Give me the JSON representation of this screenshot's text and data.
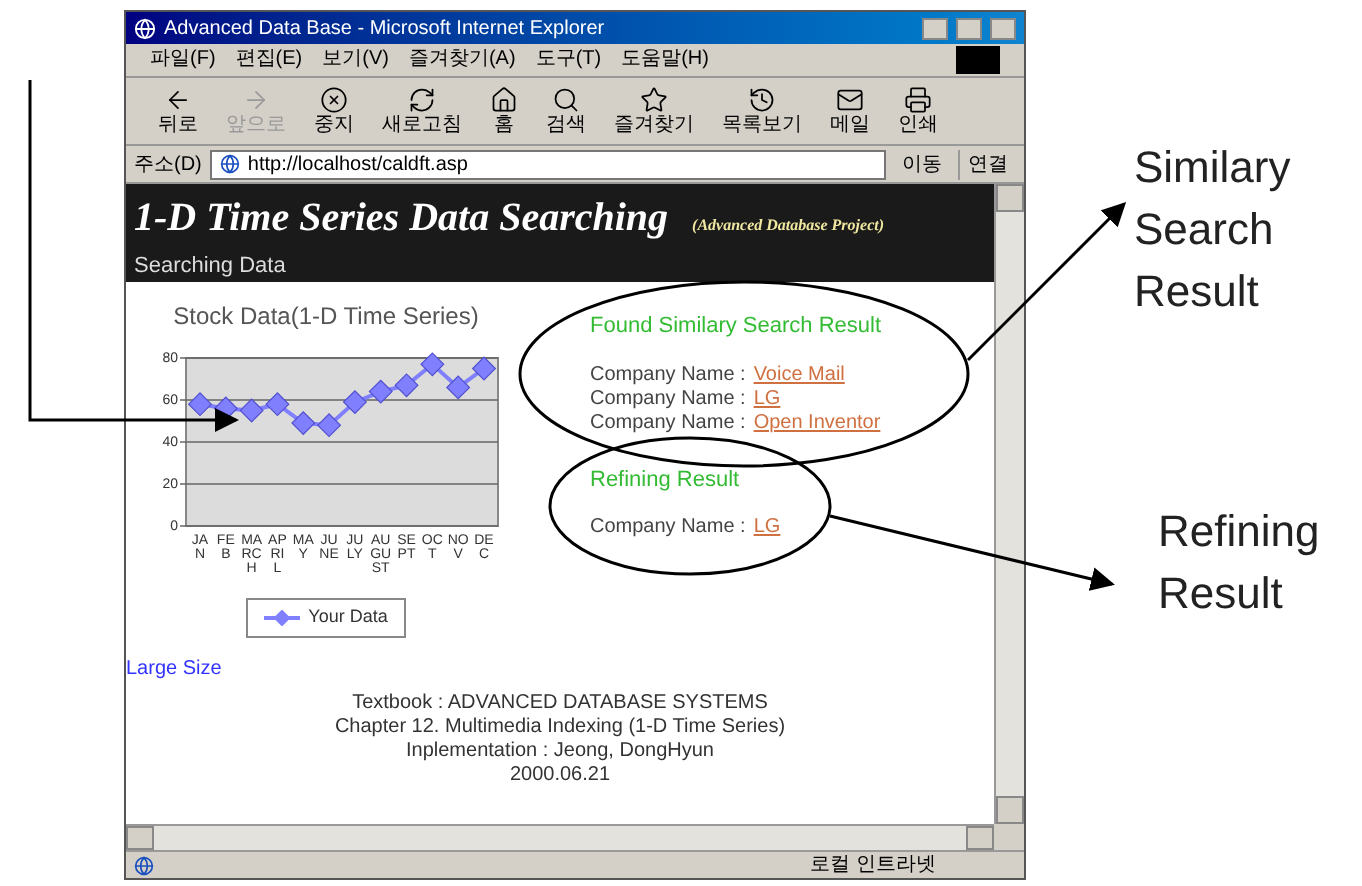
{
  "window": {
    "title": "Advanced Data Base - Microsoft Internet Explorer"
  },
  "menu": [
    "파일(F)",
    "편집(E)",
    "보기(V)",
    "즐겨찾기(A)",
    "도구(T)",
    "도움말(H)"
  ],
  "toolbar": [
    {
      "label": "뒤로",
      "disabled": false
    },
    {
      "label": "앞으로",
      "disabled": true
    },
    {
      "label": "중지",
      "disabled": false
    },
    {
      "label": "새로고침",
      "disabled": false
    },
    {
      "label": "홈",
      "disabled": false
    },
    {
      "label": "검색",
      "disabled": false
    },
    {
      "label": "즐겨찾기",
      "disabled": false
    },
    {
      "label": "목록보기",
      "disabled": false
    },
    {
      "label": "메일",
      "disabled": false
    },
    {
      "label": "인쇄",
      "disabled": false
    }
  ],
  "address_bar": {
    "label": "주소(D)",
    "value": "http://localhost/caldft.asp",
    "go": "이동",
    "links": "연결"
  },
  "page": {
    "title": "1-D Time Series Data Searching",
    "subtitle": "(Advanced Database Project)",
    "section": "Searching Data",
    "chart_data": {
      "type": "line",
      "title": "Stock Data(1-D Time Series)",
      "categories": [
        "JAN",
        "FEB",
        "MARCH",
        "APRIL",
        "MAY",
        "JUNE",
        "JULY",
        "AUGUST",
        "SEPT",
        "OCT",
        "NOV",
        "DEC"
      ],
      "yticks": [
        0,
        20,
        40,
        60,
        80
      ],
      "ylim": [
        0,
        80
      ],
      "grid": true,
      "series": [
        {
          "name": "Your Data",
          "color": "#8080ff",
          "marker": "diamond",
          "values": [
            58,
            56,
            55,
            58,
            49,
            48,
            59,
            64,
            67,
            77,
            66,
            75
          ]
        }
      ]
    },
    "large_size_link": "Large Size",
    "similar_heading": "Found Similary Search Result",
    "similar_results": [
      {
        "label": "Company Name :",
        "company": "Voice Mail"
      },
      {
        "label": "Company Name :",
        "company": "LG"
      },
      {
        "label": "Company Name :",
        "company": "Open Inventor"
      }
    ],
    "refining_heading": "Refining Result",
    "refining_results": [
      {
        "label": "Company Name :",
        "company": "LG"
      }
    ],
    "footer": [
      "Textbook : ADVANCED DATABASE SYSTEMS",
      "Chapter 12. Multimedia Indexing (1-D Time Series)",
      "Inplementation : Jeong, DongHyun",
      "2000.06.21"
    ]
  },
  "status_bar": {
    "zone": "로컬 인트라넷"
  },
  "annotations": [
    {
      "lines": [
        "Similary",
        "Search",
        "Result"
      ]
    },
    {
      "lines": [
        "Refining",
        "Result"
      ]
    }
  ]
}
